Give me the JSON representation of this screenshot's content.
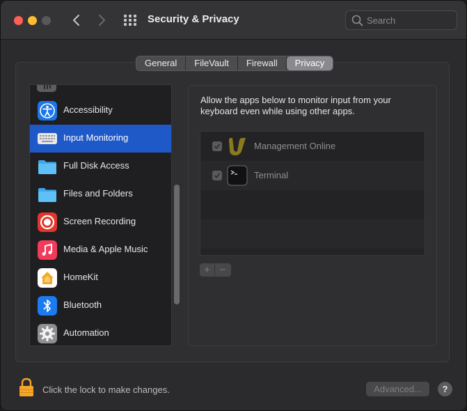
{
  "window": {
    "title": "Security & Privacy",
    "search_placeholder": "Search"
  },
  "tabs": [
    {
      "label": "General",
      "selected": false
    },
    {
      "label": "FileVault",
      "selected": false
    },
    {
      "label": "Firewall",
      "selected": false
    },
    {
      "label": "Privacy",
      "selected": true
    }
  ],
  "sidebar": {
    "items": [
      {
        "label": "Accessibility",
        "icon": "accessibility-icon",
        "selected": false
      },
      {
        "label": "Input Monitoring",
        "icon": "keyboard-icon",
        "selected": true
      },
      {
        "label": "Full Disk Access",
        "icon": "folder-icon",
        "selected": false
      },
      {
        "label": "Files and Folders",
        "icon": "folder-icon",
        "selected": false
      },
      {
        "label": "Screen Recording",
        "icon": "screen-recording-icon",
        "selected": false
      },
      {
        "label": "Media & Apple Music",
        "icon": "music-icon",
        "selected": false
      },
      {
        "label": "HomeKit",
        "icon": "home-icon",
        "selected": false
      },
      {
        "label": "Bluetooth",
        "icon": "bluetooth-icon",
        "selected": false
      },
      {
        "label": "Automation",
        "icon": "gear-icon",
        "selected": false
      }
    ]
  },
  "panel": {
    "description": "Allow the apps below to monitor input from your keyboard even while using other apps.",
    "apps": [
      {
        "name": "Management Online",
        "checked": true,
        "icon": "management-online-icon"
      },
      {
        "name": "Terminal",
        "checked": true,
        "icon": "terminal-icon"
      }
    ],
    "add_label": "+",
    "remove_label": "−"
  },
  "footer": {
    "lock_text": "Click the lock to make changes.",
    "advanced_label": "Advanced...",
    "help_label": "?"
  },
  "colors": {
    "accent": "#1f59c8",
    "close": "#fe5f57",
    "minimize": "#febc2e",
    "lock": "#f4a62a"
  }
}
